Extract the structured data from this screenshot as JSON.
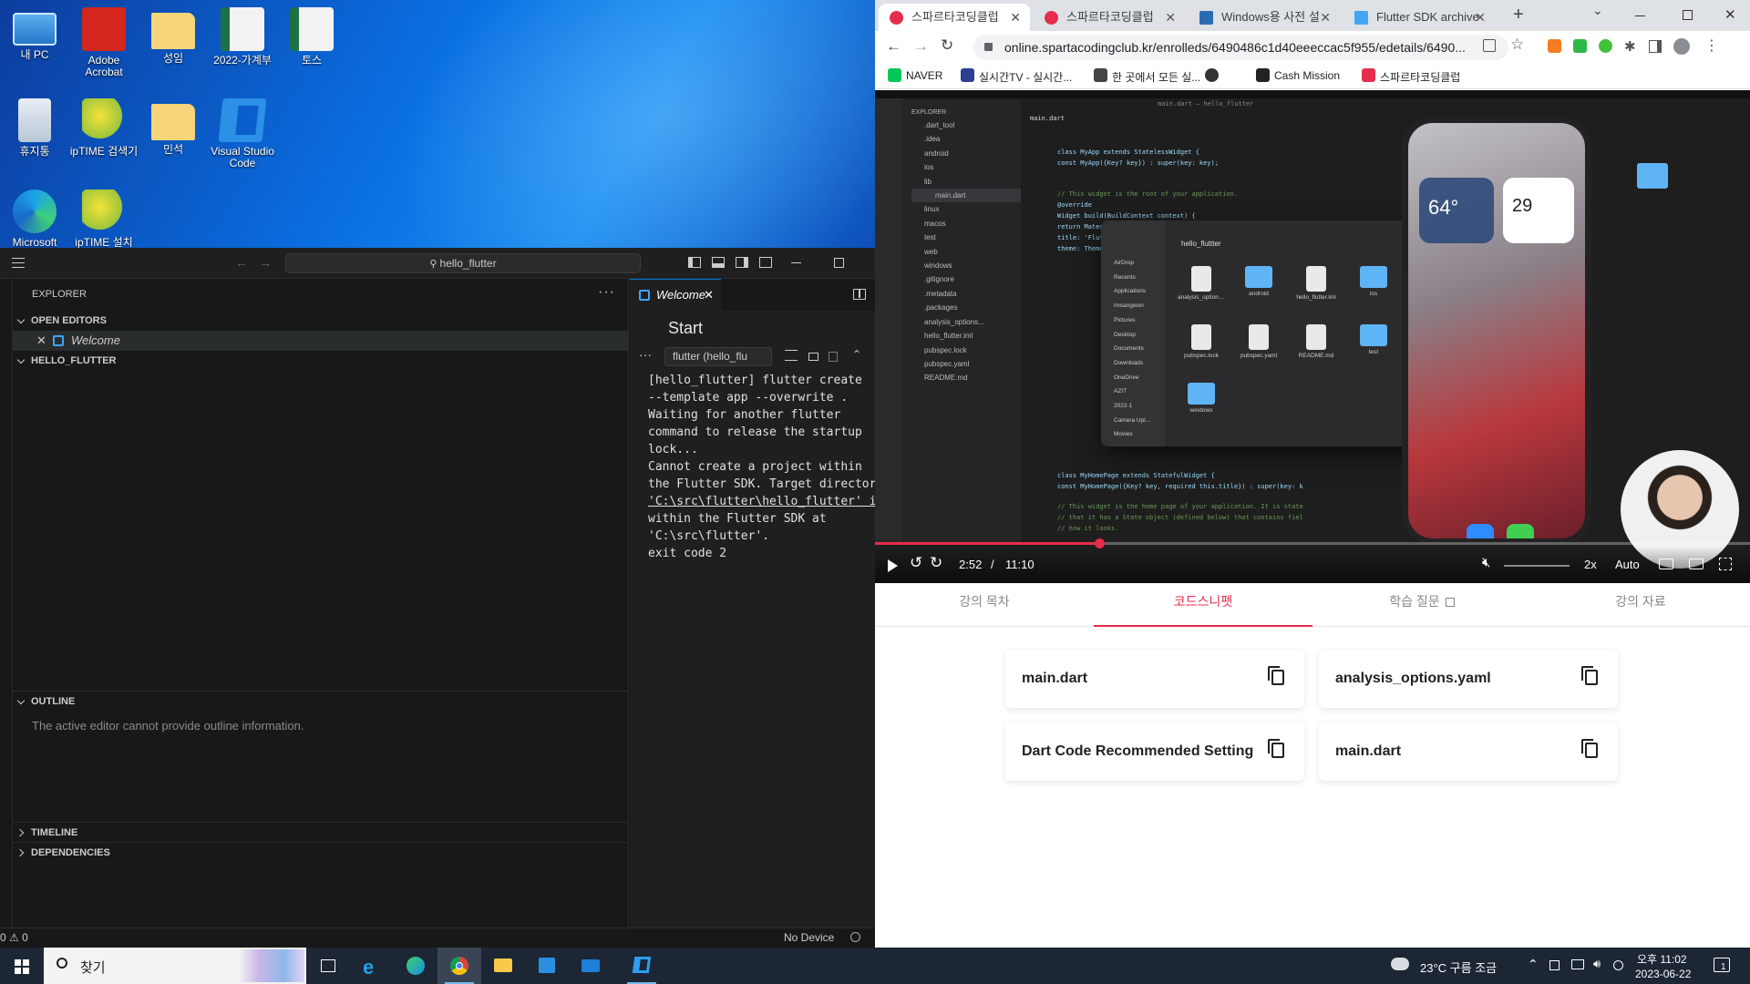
{
  "desktop": {
    "icons": [
      {
        "label": "내 PC",
        "icon": "pc-icon"
      },
      {
        "label": "Adobe Acrobat",
        "icon": "acrobat-icon"
      },
      {
        "label": "성임",
        "icon": "folder-icon"
      },
      {
        "label": "2022-가계부",
        "icon": "excel-file-icon"
      },
      {
        "label": "토스",
        "icon": "excel-file-icon"
      },
      {
        "label": "휴지통",
        "icon": "recycle-bin-icon"
      },
      {
        "label": "ipTIME 검색기",
        "icon": "iptime-icon"
      },
      {
        "label": "민석",
        "icon": "folder-icon"
      },
      {
        "label": "Visual Studio Code",
        "icon": "vscode-icon"
      },
      {
        "label": "Microsoft",
        "icon": "edge-icon"
      },
      {
        "label": "ipTIME 설치",
        "icon": "iptime-icon"
      }
    ]
  },
  "vscode": {
    "search": "hello_flutter",
    "explorer_title": "EXPLORER",
    "open_editors": "OPEN EDITORS",
    "open_file": "Welcome",
    "project": "HELLO_FLUTTER",
    "outline": "OUTLINE",
    "outline_msg": "The active editor cannot provide outline information.",
    "timeline": "TIMELINE",
    "dependencies": "DEPENDENCIES",
    "editor_tab": "Welcome",
    "start": "Start",
    "terminal_select": "flutter (hello_flu",
    "terminal_lines": [
      "[hello_flutter] flutter create",
      "--template app --overwrite .",
      "Waiting for another flutter",
      "command to release the startup",
      "lock...",
      "Cannot create a project within",
      "the Flutter SDK. Target directory",
      "'C:\\src\\flutter\\hello_flutter' is",
      "within the Flutter SDK at",
      "'C:\\src\\flutter'.",
      "exit code 2"
    ],
    "status_problems": "0 ⚠ 0",
    "status_device": "No Device"
  },
  "chrome": {
    "tabs": [
      {
        "title": "스파르타코딩클럽",
        "active": true
      },
      {
        "title": "스파르타코딩클럽",
        "active": false
      },
      {
        "title": "Windows용 사전 설",
        "active": false
      },
      {
        "title": "Flutter SDK archive",
        "active": false
      }
    ],
    "url": "online.spartacodingclub.kr/enrolleds/6490486c1d40eeeccac5f955/edetails/6490...",
    "bookmarks": [
      "NAVER",
      "실시간TV - 실시간...",
      "한 곳에서 모든 실...",
      "",
      "Cash Mission",
      "스파르타코딩클럽"
    ],
    "video": {
      "time_current": "2:52",
      "time_sep": "/",
      "time_total": "11:10",
      "speed": "2x",
      "quality": "Auto",
      "progress": 0.257
    },
    "lecture_tabs": [
      "강의 목차",
      "코드스니펫",
      "학습 질문",
      "강의 자료"
    ],
    "active_lecture_tab": 1,
    "snippets": [
      "main.dart",
      "analysis_options.yaml",
      "Dart Code Recommended Setting",
      "main.dart"
    ],
    "inner_vscode": {
      "explorer": "EXPLORER",
      "file_tab": "main.dart",
      "window_title": "main.dart — hello_flutter",
      "tree": [
        ".dart_tool",
        ".idea",
        "android",
        "ios",
        "lib",
        "main.dart",
        "linux",
        "macos",
        "test",
        "web",
        "windows",
        ".gitignore",
        ".metadata",
        ".packages",
        "analysis_options...",
        "hello_flutter.iml",
        "pubspec.lock",
        "pubspec.yaml",
        "README.md"
      ],
      "code_lines": [
        "class MyApp extends StatelessWidget {",
        "  const MyApp({Key? key}) : super(key: key);",
        "",
        "  // This widget is the root of your application.",
        "  @override",
        "  Widget build(BuildContext context) {",
        "    return MaterialApp(",
        "      title: 'Flutter Demo',",
        "      theme: ThemeData(",
        "class MyHomePage extends StatefulWidget {",
        "  const MyHomePage({Key? key, required this.title}) : super(key: k",
        "  // This widget is the home page of your application. It is state",
        "  // that it has a State object (defined below) that contains fiel",
        "  // how it looks.",
        "  // This class is the configuration for the state. It holds the v"
      ],
      "finder_title": "hello_fluttter",
      "finder_sidebar": [
        "AirDrop",
        "Recents",
        "Applications",
        "imsangwon",
        "Pictures",
        "Desktop",
        "Documents",
        "Downloads",
        "OneDrive",
        "AZIT",
        "2022-1",
        "Camera Upl...",
        "Movies"
      ],
      "finder_items": [
        "analysis_options.yaml",
        "android",
        "hello_flutter.iml",
        "ios",
        "lib",
        "linux",
        "macos",
        "pubspec.lock",
        "pubspec.yaml",
        "README.md",
        "test",
        "web",
        "windows"
      ],
      "phone_temp": "64°",
      "phone_date": "29"
    }
  },
  "taskbar": {
    "search": "찾기",
    "weather": "23°C 구름 조금",
    "time": "오후 11:02",
    "date": "2023-06-22",
    "notifications": "1"
  }
}
